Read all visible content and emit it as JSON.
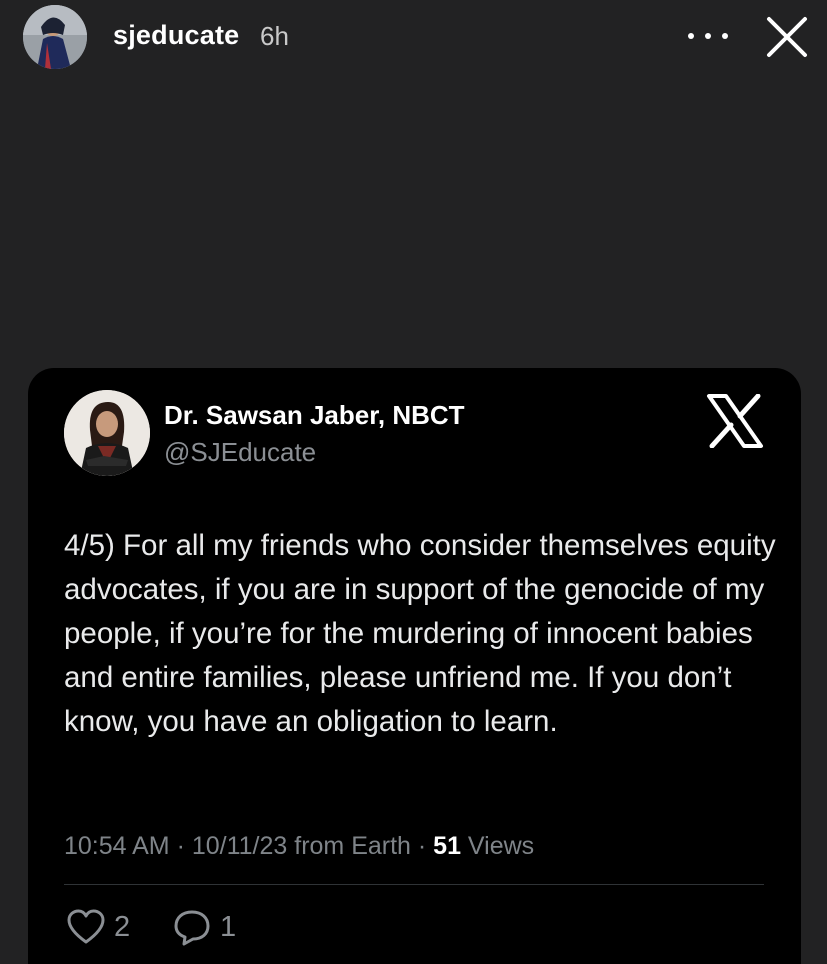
{
  "story": {
    "username": "sjeducate",
    "time": "6h",
    "icons": {
      "more": "more-options-icon",
      "close": "close-icon"
    }
  },
  "tweet": {
    "display_name": "Dr. Sawsan Jaber, NBCT",
    "handle": "@SJEducate",
    "text": "4/5) For all my friends  who consider themselves equity advocates, if you are in support of the genocide of my people,  if you’re for the murdering of innocent babies and entire families, please unfriend me. If you don’t know, you have an obligation to learn.",
    "meta_time": "10:54 AM · 10/11/23 from Earth · ",
    "views_count": "51",
    "views_label": " Views",
    "like_count": "2",
    "reply_count": "1",
    "icons": {
      "logo": "x-logo-icon",
      "like": "heart-icon",
      "reply": "reply-bubble-icon"
    }
  },
  "colors": {
    "background": "#222223",
    "card": "#000000",
    "secondary_text": "#8b8f94"
  }
}
